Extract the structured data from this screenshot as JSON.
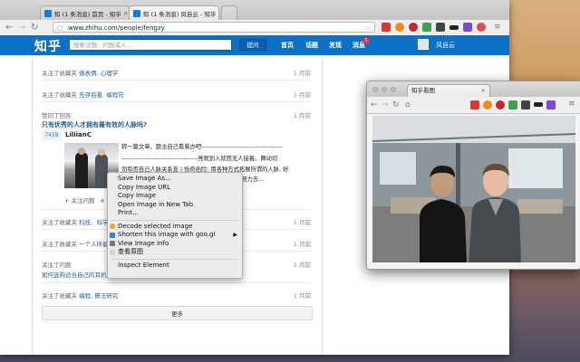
{
  "browser": {
    "tabs": [
      {
        "label": "知 (1 条消息) 首页 - 知乎",
        "active": false
      },
      {
        "label": "知 (1 条消息) 风自云 - 知乎",
        "active": true
      }
    ],
    "url": "www.zhihu.com/people/fengzy"
  },
  "zhihu": {
    "logo": "知乎",
    "search_placeholder": "搜索话题、问题或人...",
    "ask_button": "提问",
    "nav": [
      "首页",
      "话题",
      "发现",
      "消息"
    ],
    "message_count": "1",
    "username": "风自云"
  },
  "feed": [
    {
      "prefix": "关注了收藏夹",
      "title": "微表情, 心理学",
      "time": "1 月前"
    },
    {
      "prefix": "关注了收藏夹",
      "title": "先存后看, 编程向",
      "time": "1 月前"
    },
    {
      "prefix": "赞同了回答",
      "time": "1 月前"
    },
    {
      "prefix": "关注了收藏夹",
      "title": "科技、科学",
      "time": "1 月前"
    },
    {
      "prefix": "关注了收藏夹",
      "title": "一个人所能",
      "time": "1 月前"
    },
    {
      "prefix": "关注了问题",
      "time": "1 月前"
    },
    {
      "prefix": "关注了收藏夹",
      "title": "编程, 算法研究",
      "time": "1 月前"
    }
  ],
  "answer": {
    "question": "只有优秀的人才拥有最有效的人脉吗?",
    "votes": "7459",
    "author": "LiliianC",
    "lines": [
      "转一篇文章。题主自己看着办吧---------------------------------------",
      "-------------------------------------亮观到入就而无人接着。舞动切",
      "勿有否自己人脉关系支 | 恰奇函险: 用各种方式拓展所谓的人脉, 好",
      "其次是让对方给了给到你。多要他们一切。于是努力去..."
    ],
    "follow": "+ 关注问题",
    "comments": "4"
  },
  "followed_question": "如何选购适合自己的耳机?",
  "more_button": "更多",
  "context_menu": {
    "group1": [
      "Save Image As...",
      "Copy Image URL",
      "Copy Image",
      "Open Image in New Tab",
      "Print..."
    ],
    "group2": [
      "Decode selected image",
      "Shorten this image with goo.gl",
      "View Image Info",
      "查看原图"
    ],
    "group3": [
      "Inspect Element"
    ]
  },
  "viewer": {
    "tab_title": "知乎看图"
  },
  "colors": {
    "zhihu_blue": "#0c70c7",
    "link_blue": "#1d5d9e"
  }
}
